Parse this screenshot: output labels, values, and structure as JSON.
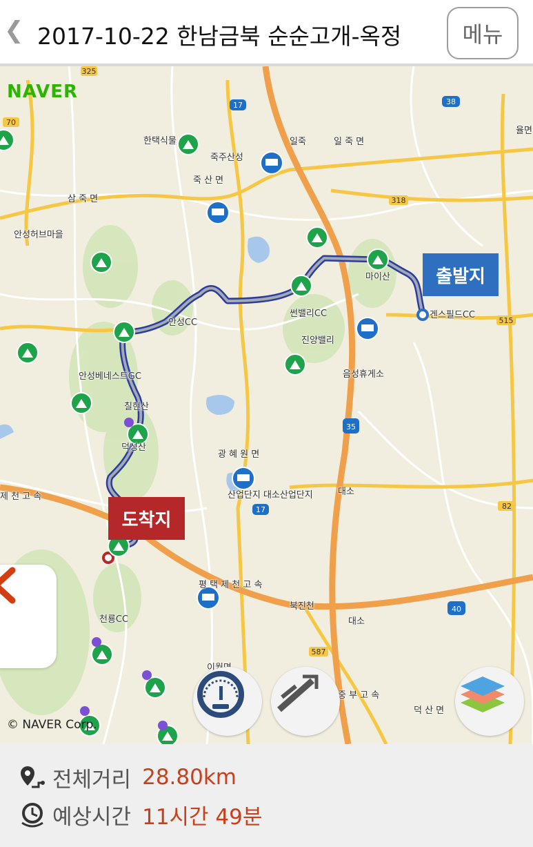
{
  "header": {
    "back_icon": "chevron-left-icon",
    "title": "2017-10-22 한남금북 순순고개-옥정",
    "menu_label": "메뉴"
  },
  "map": {
    "brand": "NAVER",
    "copyright": "© NAVER Corp.",
    "start_label": "출발지",
    "end_label": "도착지",
    "route_color": "#2a3d9e",
    "road_shields": [
      "325",
      "17",
      "38",
      "70",
      "318",
      "515",
      "35",
      "82",
      "40",
      "587",
      "17"
    ],
    "place_labels": [
      "한택식물",
      "죽주산성",
      "일죽",
      "일 죽 면",
      "죽 산 면",
      "삼 죽 면",
      "안성허브마을",
      "마이산",
      "겐스필드CC",
      "썬밸리CC",
      "진양밸리",
      "안성CC",
      "음성휴게소",
      "안성베네스트GC",
      "칠현산",
      "광 혜 원 면",
      "산업단지 대소산업단지",
      "대소",
      "덕성산",
      "평 택 제 천 고 속",
      "북진천",
      "대소",
      "천룡CC",
      "덕 산 면",
      "율면",
      "제 천 고 속",
      "중 부 고 속",
      "이월면"
    ]
  },
  "controls": {
    "side_back_icon": "chevron-left-icon",
    "speed_icon": "speedometer-icon",
    "slope_icon": "elevation-icon",
    "layers_icon": "layers-icon"
  },
  "summary": {
    "distance_label": "전체거리",
    "distance_value": "28.80km",
    "time_label": "예상시간",
    "time_value": "11시간 49분"
  }
}
